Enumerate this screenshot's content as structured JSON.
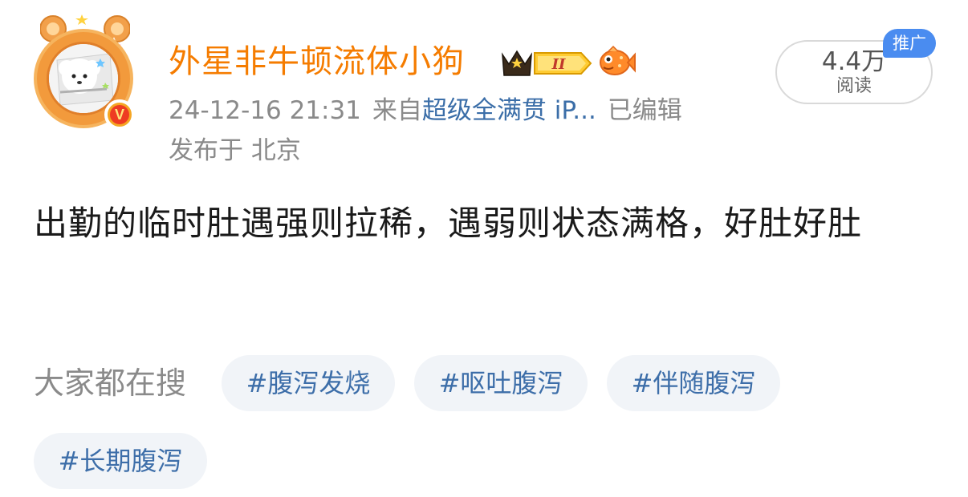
{
  "post": {
    "username": "外星非牛顿流体小狗",
    "timestamp": "24-12-16 21:31",
    "source_prefix": "来自",
    "source": "超级全满贯 iP...",
    "edited": "已编辑",
    "location": "发布于 北京",
    "views_count": "4.4万",
    "views_label": "阅读",
    "promo_tag": "推广",
    "verified_mark": "V",
    "badge_level": "II",
    "body": "出勤的临时肚遇强则拉稀，遇弱则状态满格，好肚好肚"
  },
  "trending": {
    "label": "大家都在搜",
    "tags": [
      "#腹泻发烧",
      "#呕吐腹泻",
      "#伴随腹泻",
      "#长期腹泻"
    ]
  },
  "colors": {
    "username": "#f57c00",
    "link": "#3b6ea8",
    "meta": "#8a8a8a",
    "tag_bg": "#f1f4f8",
    "promo": "#4a8cf0"
  },
  "icons": {
    "avatar": "dog-avatar",
    "verified": "verified-badge-icon",
    "crown": "crown-level-badge-icon",
    "fish": "fish-badge-icon"
  }
}
